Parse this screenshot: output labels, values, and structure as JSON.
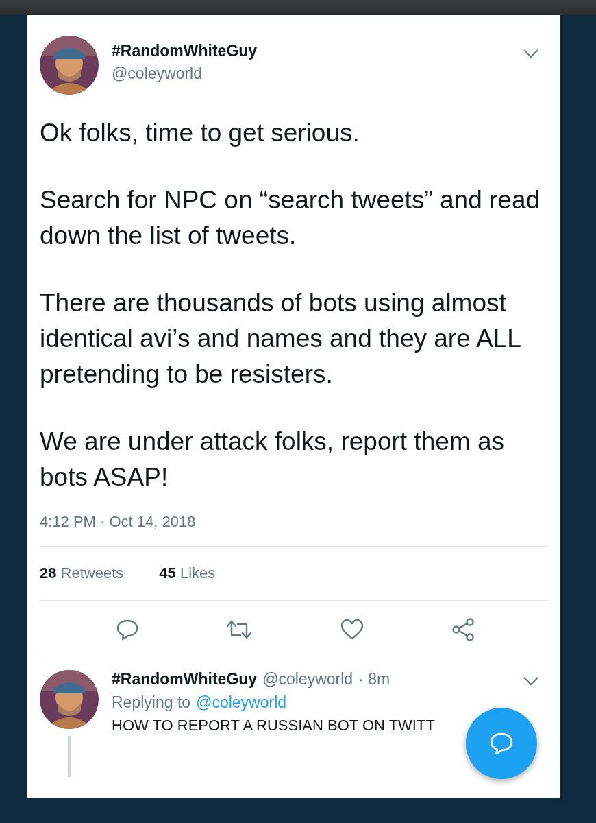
{
  "tweet": {
    "name": "#RandomWhiteGuy",
    "handle": "@coleyworld",
    "paragraphs": [
      "Ok folks, time to get serious.",
      "Search for NPC on “search tweets” and read down the list of tweets.",
      "There are thousands of bots using almost identical avi’s and names and they are ALL pretending to be resisters.",
      "We are under attack folks, report them as bots ASAP!"
    ],
    "timestamp": "4:12 PM · Oct 14, 2018",
    "stats": [
      {
        "count": "28",
        "label": "Retweets"
      },
      {
        "count": "45",
        "label": "Likes"
      }
    ]
  },
  "reply": {
    "name": "#RandomWhiteGuy",
    "handle": "@coleyworld",
    "time": "· 8m",
    "replying_label": "Replying to",
    "replying_to": "@coleyworld",
    "text": "HOW TO REPORT A RUSSIAN BOT ON TWITT"
  }
}
